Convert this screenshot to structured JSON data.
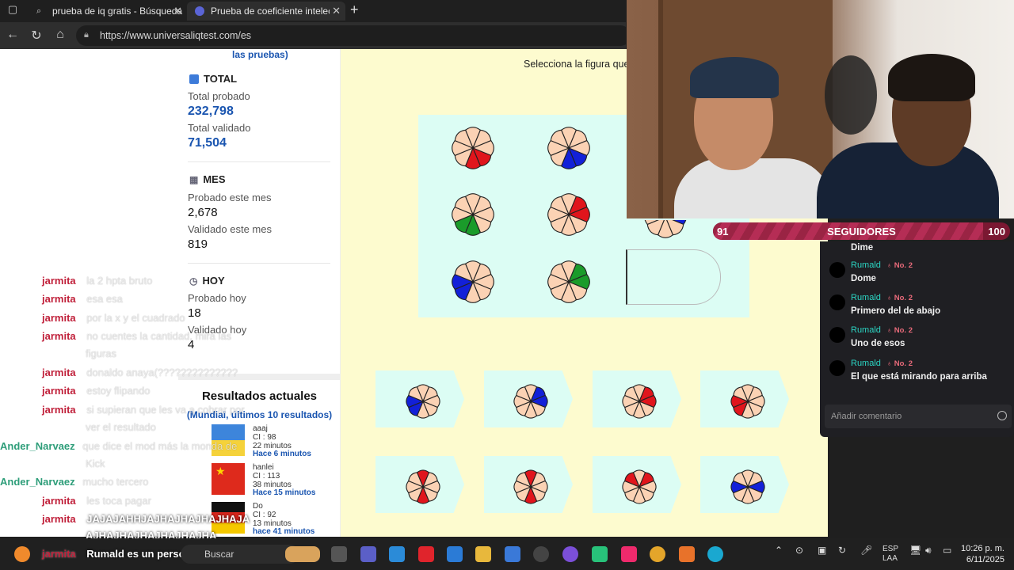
{
  "browser": {
    "tabs": [
      {
        "label": "prueba de iq gratis - Búsqueda",
        "active": false
      },
      {
        "label": "Prueba de coeficiente intelectual",
        "active": true
      }
    ],
    "url": "https://www.universaliqtest.com/es"
  },
  "stats": {
    "top_link": "las pruebas)",
    "total": {
      "heading": "TOTAL",
      "tested_label": "Total probado",
      "tested_value": "232,798",
      "validated_label": "Total validado",
      "validated_value": "71,504"
    },
    "month": {
      "heading": "MES",
      "tested_label": "Probado este mes",
      "tested_value": "2,678",
      "validated_label": "Validado este mes",
      "validated_value": "819"
    },
    "today": {
      "heading": "HOY",
      "tested_label": "Probado hoy",
      "tested_value": "18",
      "validated_label": "Validado hoy",
      "validated_value": "4"
    },
    "results": {
      "title": "Resultados actuales",
      "subtitle": "(Mundial, últimos 10 resultados)",
      "items": [
        {
          "name": "aaaj",
          "ci": "CI : 98",
          "time": "22 minutos",
          "ago": "Hace 6 minutos",
          "flag": "ukraine"
        },
        {
          "name": "hanlei",
          "ci": "CI : 113",
          "time": "38 minutos",
          "ago": "Hace 15 minutos",
          "flag": "china"
        },
        {
          "name": "Do",
          "ci": "CI : 92",
          "time": "13 minutos",
          "ago": "hace 41 minutos",
          "flag": "germany"
        }
      ]
    }
  },
  "puzzle": {
    "instruction": "Selecciona la figura que f"
  },
  "overlay_chat": [
    {
      "user": "jarmita",
      "msg": "la 2 hpta bruto"
    },
    {
      "user": "jarmita",
      "msg": "esa esa"
    },
    {
      "user": "jarmita",
      "msg": "por la x y el cuadrado"
    },
    {
      "user": "jarmita",
      "msg": "no cuentes la cantidad, mira las"
    },
    {
      "user": "",
      "msg": "figuras"
    },
    {
      "user": "jarmita",
      "msg": "donaldo anaya(??????????????"
    },
    {
      "user": "jarmita",
      "msg": "estoy flipando"
    },
    {
      "user": "jarmita",
      "msg": "si supieran que les va a cobrar por"
    },
    {
      "user": "",
      "msg": "ver el resultado"
    },
    {
      "user": "Ander_Narvaez",
      "msg": "que dice el mod más la monda de"
    },
    {
      "user": "",
      "msg": "Kick"
    },
    {
      "user": "Ander_Narvaez",
      "msg": "mucho tercero"
    },
    {
      "user": "jarmita",
      "msg": "les toca pagar"
    },
    {
      "user": "jarmita",
      "msg": "JAJAJAHHJAJHAJHAJHAJHAJA"
    },
    {
      "user": "",
      "msg": "AJHAJHAJHAJHAJHAJHA"
    },
    {
      "user": "jarmita",
      "msg": "Rumald es un persona"
    }
  ],
  "follow_goal": {
    "current": "91",
    "label": "SEGUIDORES",
    "target": "100",
    "progress": 0.91
  },
  "chat": {
    "first_line": "Dime",
    "messages": [
      {
        "user": "Rumald",
        "badge": "No. 2",
        "text": "Dome"
      },
      {
        "user": "Rumald",
        "badge": "No. 2",
        "text": "Primero del de abajo"
      },
      {
        "user": "Rumald",
        "badge": "No. 2",
        "text": "Uno de esos"
      },
      {
        "user": "Rumald",
        "badge": "No. 2",
        "text": "El que está mirando para arriba"
      }
    ],
    "input_placeholder": "Añadir comentario"
  },
  "taskbar": {
    "search_placeholder": "Buscar",
    "lang": "ESP",
    "lang2": "LAA",
    "time": "10:26 p. m.",
    "date": "6/11/2025"
  },
  "colors": {
    "accent_blue": "#1a55b0",
    "puzzle_bg": "#dcfdf4",
    "page_bg": "#fdfbcf",
    "goal_bar": "#7a1832"
  }
}
